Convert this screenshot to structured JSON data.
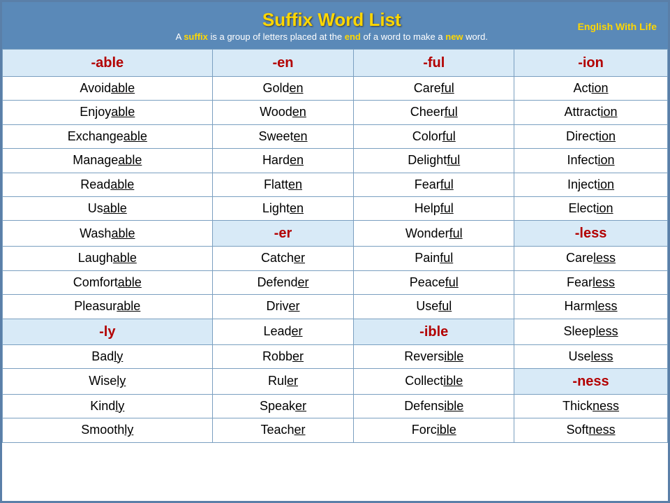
{
  "header": {
    "title": "Suffix Word List",
    "subtitle_start": "A ",
    "subtitle_suffix": "suffix",
    "subtitle_mid": " is a group of letters placed at the ",
    "subtitle_end_bold": "end",
    "subtitle_end": " of a word to make a ",
    "subtitle_new": "new",
    "subtitle_final": " word.",
    "brand": "English With Life"
  },
  "columns": [
    "-able",
    "-en",
    "-ful",
    "-ion"
  ],
  "rows": [
    [
      "Avoidable|able",
      "Golden|en",
      "Careful|ful",
      "Action|ion"
    ],
    [
      "Enjoyable|able",
      "Wooden|en",
      "Cheerful|ful",
      "Attraction|ion"
    ],
    [
      "Exchangeable|able",
      "Sweeten|en",
      "Colorful|ful",
      "Direction|ion"
    ],
    [
      "Manageable|able",
      "Harden|en",
      "Delightful|ful",
      "Infection|ion"
    ],
    [
      "Readable|able",
      "Flatten|en",
      "Fearful|ful",
      "Injection|ion"
    ],
    [
      "Usable|able",
      "Lighten|en",
      "Helpful|ful",
      "Election|ion"
    ],
    [
      "Washable|able",
      "-er",
      "Wonderful|ful",
      "-less"
    ],
    [
      "Laughable|able",
      "Catcher|er",
      "Painful|ful",
      "Careless|less"
    ],
    [
      "Comfortable|able",
      "Defender|er",
      "Peaceful|ful",
      "Fearless|less"
    ],
    [
      "Pleasurable|able",
      "Driver|er",
      "Useful|ful",
      "Harmless|less"
    ],
    [
      "-ly",
      "Leader|er",
      "-ible",
      "Sleepless|less"
    ],
    [
      "Badly|ly",
      "Robber|er",
      "Reversible|ible",
      "Useless|less"
    ],
    [
      "Wisely|ly",
      "Ruler|er",
      "Collectible|ible",
      "-ness"
    ],
    [
      "Kindly|ly",
      "Speaker|er",
      "Defensible|ible",
      "Thickness|ness"
    ],
    [
      "Smoothly|ly",
      "Teacher|er",
      "Forcible|ible",
      "Softness|ness"
    ]
  ]
}
